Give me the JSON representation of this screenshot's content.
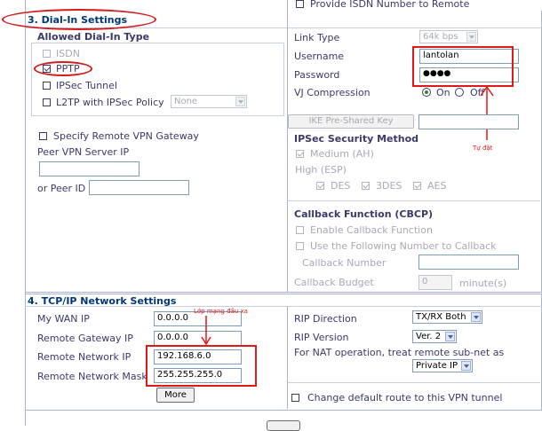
{
  "dialin": {
    "title": "3. Dial-In Settings",
    "provide_isdn": "Provide ISDN Number to Remote",
    "allowed_type": "Allowed Dial-In Type",
    "isdn": "ISDN",
    "pptp": "PPTP",
    "ipsec_tunnel": "IPSec Tunnel",
    "l2tp": "L2TP with IPSec Policy",
    "l2tp_policy": "None",
    "specify_gateway": "Specify Remote VPN Gateway",
    "peer_server_ip": "Peer VPN Server IP",
    "peer_server_ip_value": "",
    "or_peer_id": "or Peer ID",
    "peer_id_value": "",
    "link_type": "Link Type",
    "link_type_value": "64k bps",
    "username": "Username",
    "username_value": "lantolan",
    "password": "Password",
    "password_value": "●●●●",
    "vj": "VJ Compression",
    "vj_on": "On",
    "vj_off": "Off",
    "ike_btn": "IKE Pre-Shared Key",
    "ike_value": "",
    "ipsec_method": "IPSec Security Method",
    "medium": "Medium (AH)",
    "high": "High (ESP)",
    "des": "DES",
    "des3": "3DES",
    "aes": "AES",
    "callback_title": "Callback Function (CBCP)",
    "enable_callback": "Enable Callback Function",
    "use_following": "Use the Following Number to Callback",
    "callback_number": "Callback Number",
    "callback_number_value": "",
    "callback_budget": "Callback Budget",
    "callback_budget_value": "0",
    "minutes": "minute(s)",
    "annotation_tudat": "Tự đặt"
  },
  "tcpip": {
    "title": "4. TCP/IP Network Settings",
    "my_wan_ip": "My WAN IP",
    "my_wan_ip_value": "0.0.0.0",
    "remote_gw": "Remote Gateway IP",
    "remote_gw_value": "0.0.0.0",
    "remote_net_ip": "Remote Network IP",
    "remote_net_ip_value": "192.168.6.0",
    "remote_mask": "Remote Network Mask",
    "remote_mask_value": "255.255.255.0",
    "more_btn": "More",
    "rip_direction": "RIP Direction",
    "rip_direction_value": "TX/RX Both",
    "rip_version": "RIP Version",
    "rip_version_value": "Ver. 2",
    "nat_text": "For NAT operation, treat remote sub-net as",
    "nat_value": "Private IP",
    "change_default": "Change default route to this VPN tunnel",
    "annotation_lop": "Lớp mạng đầu xa"
  },
  "colors": {
    "header": "#00377a",
    "text": "#3a3a6a",
    "annotation": "#e01818",
    "border": "#a9b4d3"
  }
}
